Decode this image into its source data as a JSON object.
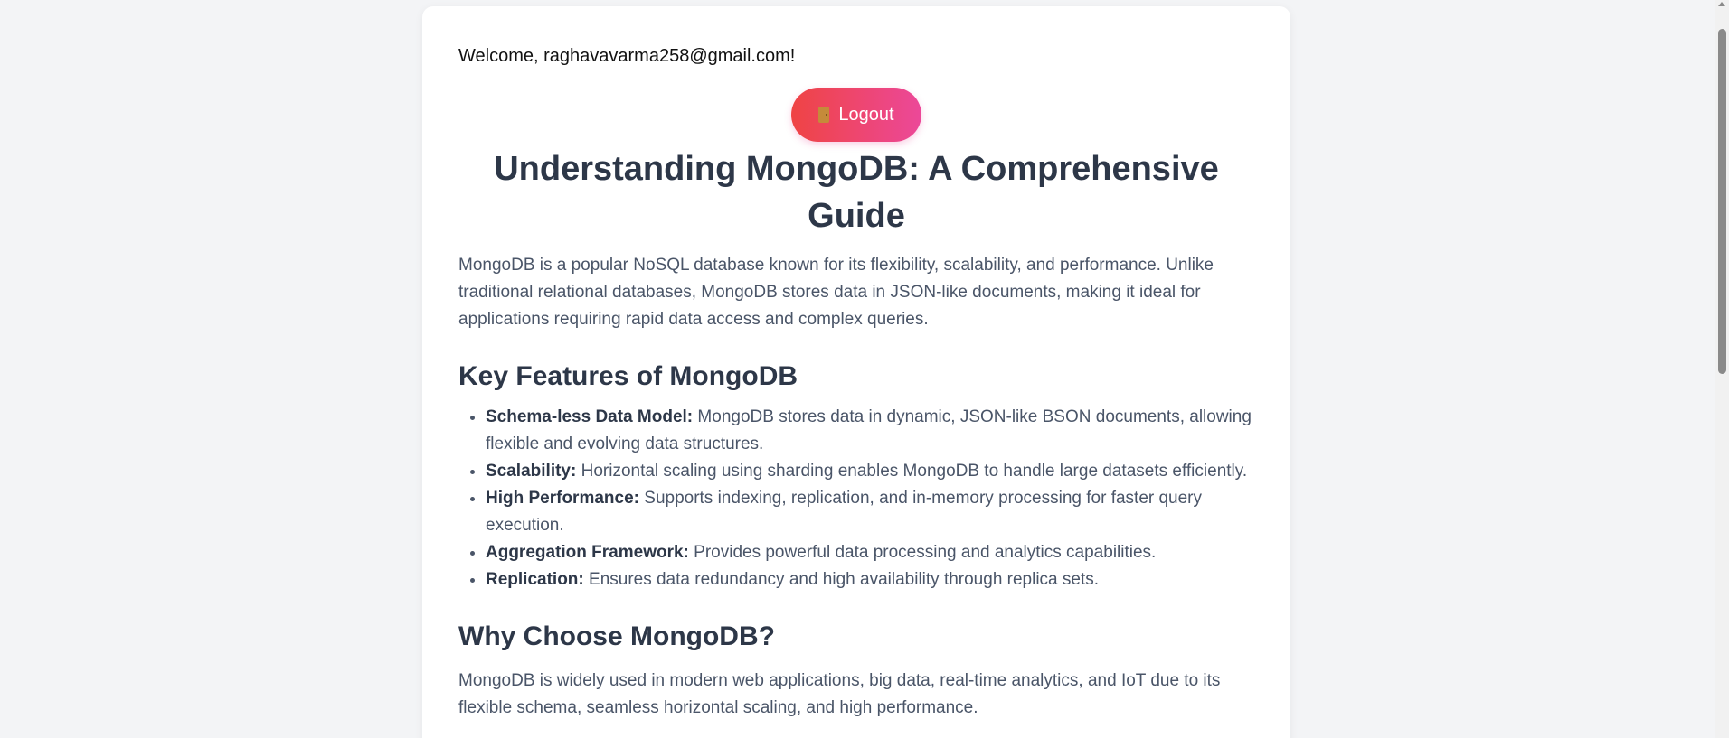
{
  "header": {
    "welcome_text": "Welcome, raghavavarma258@gmail.com!",
    "logout_icon": "door-icon",
    "logout_label": "Logout"
  },
  "article": {
    "title": "Understanding MongoDB: A Comprehensive Guide",
    "intro": "MongoDB is a popular NoSQL database known for its flexibility, scalability, and performance. Unlike traditional relational databases, MongoDB stores data in JSON-like documents, making it ideal for applications requiring rapid data access and complex queries.",
    "features_heading": "Key Features of MongoDB",
    "features": [
      {
        "term": "Schema-less Data Model:",
        "text": "MongoDB stores data in dynamic, JSON-like BSON documents, allowing flexible and evolving data structures."
      },
      {
        "term": "Scalability:",
        "text": "Horizontal scaling using sharding enables MongoDB to handle large datasets efficiently."
      },
      {
        "term": "High Performance:",
        "text": "Supports indexing, replication, and in-memory processing for faster query execution."
      },
      {
        "term": "Aggregation Framework:",
        "text": "Provides powerful data processing and analytics capabilities."
      },
      {
        "term": "Replication:",
        "text": "Ensures data redundancy and high availability through replica sets."
      }
    ],
    "why_heading": "Why Choose MongoDB?",
    "why_text": "MongoDB is widely used in modern web applications, big data, real-time analytics, and IoT due to its flexible schema, seamless horizontal scaling, and high performance."
  },
  "colors": {
    "page_bg": "#f3f4f6",
    "card_bg": "#ffffff",
    "heading": "#2d3748",
    "body_text": "#4a5568",
    "logout_gradient_start": "#ef4444",
    "logout_gradient_end": "#ec4899"
  }
}
